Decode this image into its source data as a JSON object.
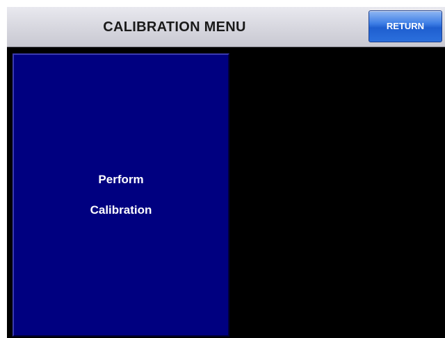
{
  "header": {
    "title": "CALIBRATION MENU",
    "return_label": "RETURN"
  },
  "menu": {
    "perform_calibration": {
      "line1": "Perform",
      "line2": "Calibration"
    }
  },
  "colors": {
    "screen_background": "#000000",
    "header_background": "#d6d6de",
    "button_blue": "#000080",
    "return_button_blue": "#2b6fdc",
    "text_white": "#ffffff"
  }
}
